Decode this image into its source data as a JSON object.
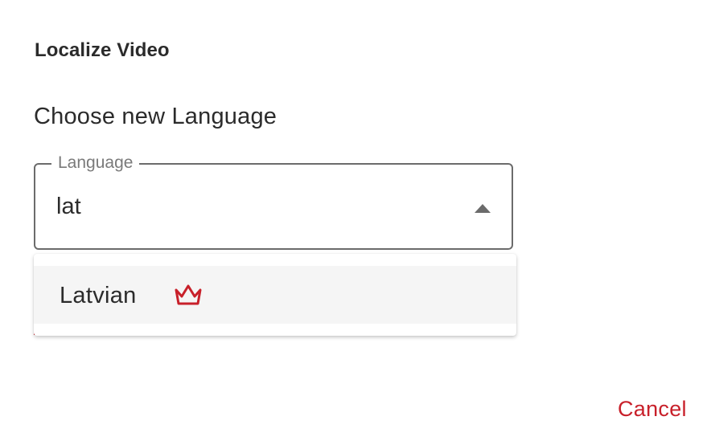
{
  "dialog": {
    "title": "Localize Video",
    "section_heading": "Choose new Language"
  },
  "language_field": {
    "label": "Language",
    "value": "lat"
  },
  "dropdown": {
    "options": [
      {
        "label": "Latvian",
        "icon": "crown-icon"
      }
    ]
  },
  "actions": {
    "cancel_label": "Cancel"
  },
  "colors": {
    "accent": "#c8202a",
    "text": "#2b2b2b",
    "muted": "#7a7a7a",
    "border": "#6b6b6b",
    "option_highlight": "#f5f5f5"
  }
}
